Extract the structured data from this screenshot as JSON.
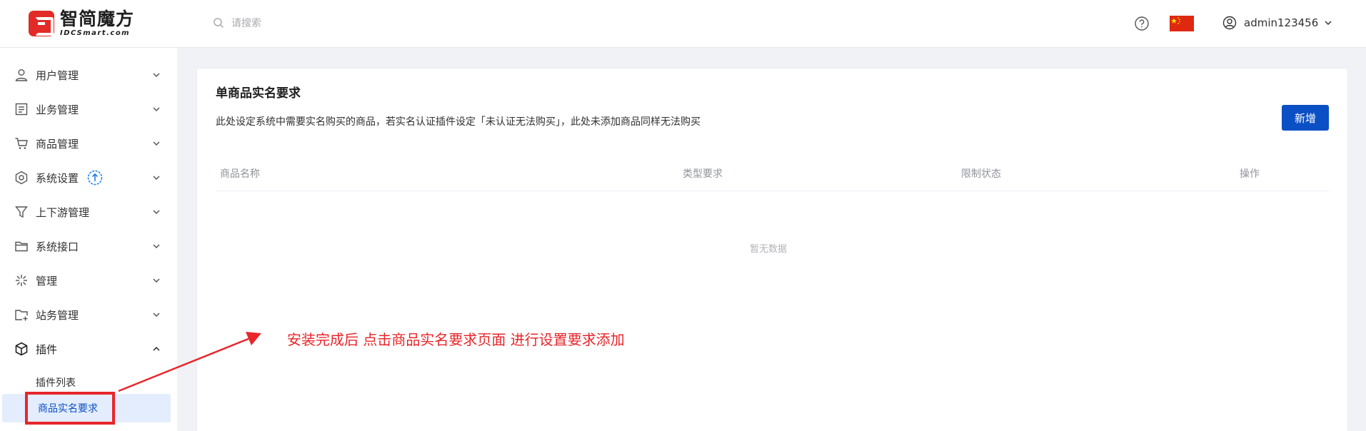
{
  "header": {
    "logo_cn": "智简魔方",
    "logo_en": "IDCSmart.com",
    "search_placeholder": "请搜索",
    "username": "admin123456"
  },
  "sidebar": {
    "items": [
      {
        "label": "用户管理",
        "icon": "user-icon"
      },
      {
        "label": "业务管理",
        "icon": "document-icon"
      },
      {
        "label": "商品管理",
        "icon": "cart-icon"
      },
      {
        "label": "系统设置",
        "icon": "settings-icon"
      },
      {
        "label": "上下游管理",
        "icon": "filter-icon"
      },
      {
        "label": "系统接口",
        "icon": "folder-icon"
      },
      {
        "label": "管理",
        "icon": "sparkle-icon"
      },
      {
        "label": "站务管理",
        "icon": "folder-add-icon"
      },
      {
        "label": "插件",
        "icon": "cube-icon"
      }
    ],
    "sub_items": [
      {
        "label": "插件列表"
      },
      {
        "label": "商品实名要求"
      }
    ]
  },
  "main": {
    "title": "单商品实名要求",
    "description": "此处设定系统中需要实名购买的商品，若实名认证插件设定「未认证无法购买」，此处未添加商品同样无法购买",
    "add_button": "新增",
    "columns": [
      "商品名称",
      "类型要求",
      "限制状态",
      "操作"
    ],
    "empty_text": "暂无数据"
  },
  "annotation": {
    "note": "安装完成后 点击商品实名要求页面 进行设置要求添加"
  },
  "colors": {
    "primary": "#0b4fc4",
    "annotation_red": "#e8262b",
    "logo_red": "#e22a27",
    "active_bg": "#e4edfd"
  }
}
